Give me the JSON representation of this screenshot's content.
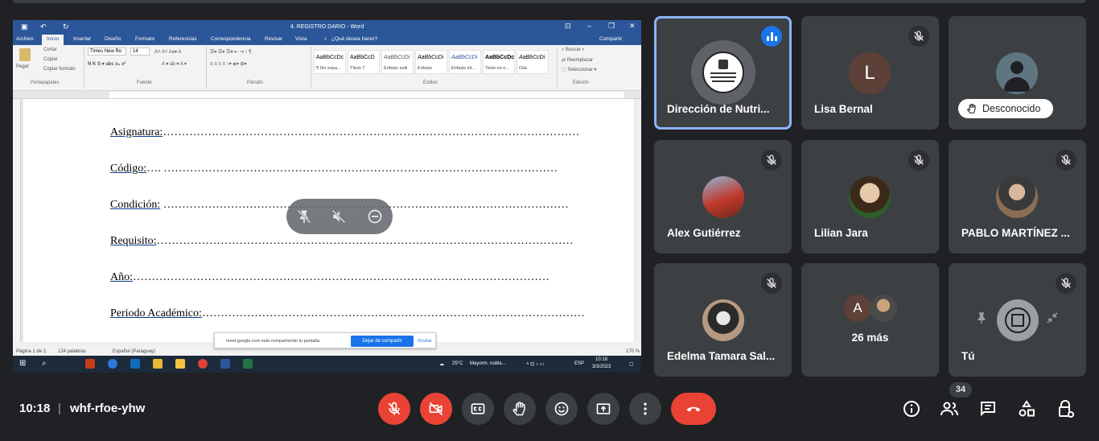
{
  "meeting": {
    "time": "10:18",
    "separator": "|",
    "code": "whf-rfoe-yhw",
    "participant_count": "34"
  },
  "word": {
    "title": "4. REGISTRO DARIO - Word",
    "tabs": [
      "Archivo",
      "Inicio",
      "Insertar",
      "Diseño",
      "Formato",
      "Referencias",
      "Correspondencia",
      "Revisar",
      "Vista"
    ],
    "tell_me": "¿Qué desea hacer?",
    "share": "Compartir",
    "clipboard": {
      "paste": "Pegar",
      "cut": "Cortar",
      "copy": "Copiar",
      "format_painter": "Copiar formato"
    },
    "font_name": "Times New Ro",
    "font_size": "14",
    "groups": [
      "Portapapeles",
      "Fuente",
      "Párrafo",
      "Estilos",
      "Edición"
    ],
    "styles": [
      {
        "sample": "AaBbCcDc",
        "name": "¶ Sin espa..."
      },
      {
        "sample": "AaBbCcD",
        "name": "Título 7"
      },
      {
        "sample": "AaBbCcDi",
        "name": "Énfasis sutil"
      },
      {
        "sample": "AaBbCcDi",
        "name": "Énfasis"
      },
      {
        "sample": "AaBbCcDi",
        "name": "Énfasis int..."
      },
      {
        "sample": "AaBbCcDc",
        "name": "Texto en n..."
      },
      {
        "sample": "AaBbCcDi",
        "name": "Cita"
      }
    ],
    "editing": {
      "find": "Buscar",
      "replace": "Reemplazar",
      "select": "Seleccionar"
    },
    "doc_lines": [
      {
        "label": "Asignatura:",
        "dots": "…………………………………………………………………………………………………"
      },
      {
        "label": "Código:",
        "dots": "…. ……………………………………………………………………………………………"
      },
      {
        "label": "Condición:",
        "dots": " ………………………………………………………………………………………………"
      },
      {
        "label": "Requisito:",
        "dots": "…………………………………………………………………………………………………"
      },
      {
        "label": "Año:",
        "dots": "…………………………………………………………………………………………………"
      },
      {
        "label": "Periodo Académico:",
        "dots": "…………………………………………………………………………………………"
      }
    ],
    "status": {
      "page": "Página 1 de 2",
      "words": "124 palabras",
      "language": "Español (Paraguay)",
      "zoom": "170 %"
    },
    "share_notice": {
      "message": "meet.google.com está compartiendo tu pantalla.",
      "stop": "Dejar de compartir",
      "hide": "Ocultar"
    },
    "taskbar": {
      "weather": "25°C",
      "weather_desc": "Mayorm. nubla...",
      "lang": "ESP",
      "time": "10:18",
      "date": "3/3/2023"
    }
  },
  "participants": [
    {
      "name": "Dirección de Nutri...",
      "speaking": true
    },
    {
      "name": "Lisa Bernal",
      "initial": "L",
      "muted": true
    },
    {
      "name": "Desconocido",
      "muted": false
    },
    {
      "name": "Alex Gutiérrez",
      "muted": true
    },
    {
      "name": "Lilian Jara",
      "muted": true
    },
    {
      "name": "PABLO MARTÍNEZ ...",
      "muted": true
    },
    {
      "name": "Edelma Tamara Sal...",
      "muted": true
    },
    {
      "name": "26 más",
      "initial": "A"
    },
    {
      "name": "Tú",
      "muted": true
    }
  ],
  "colors": {
    "background": "#202124",
    "tile": "#3c4043",
    "red": "#ea4335",
    "blue": "#1a73e8",
    "word_blue": "#2b579a",
    "speaking_outline": "#8ab4f8"
  }
}
